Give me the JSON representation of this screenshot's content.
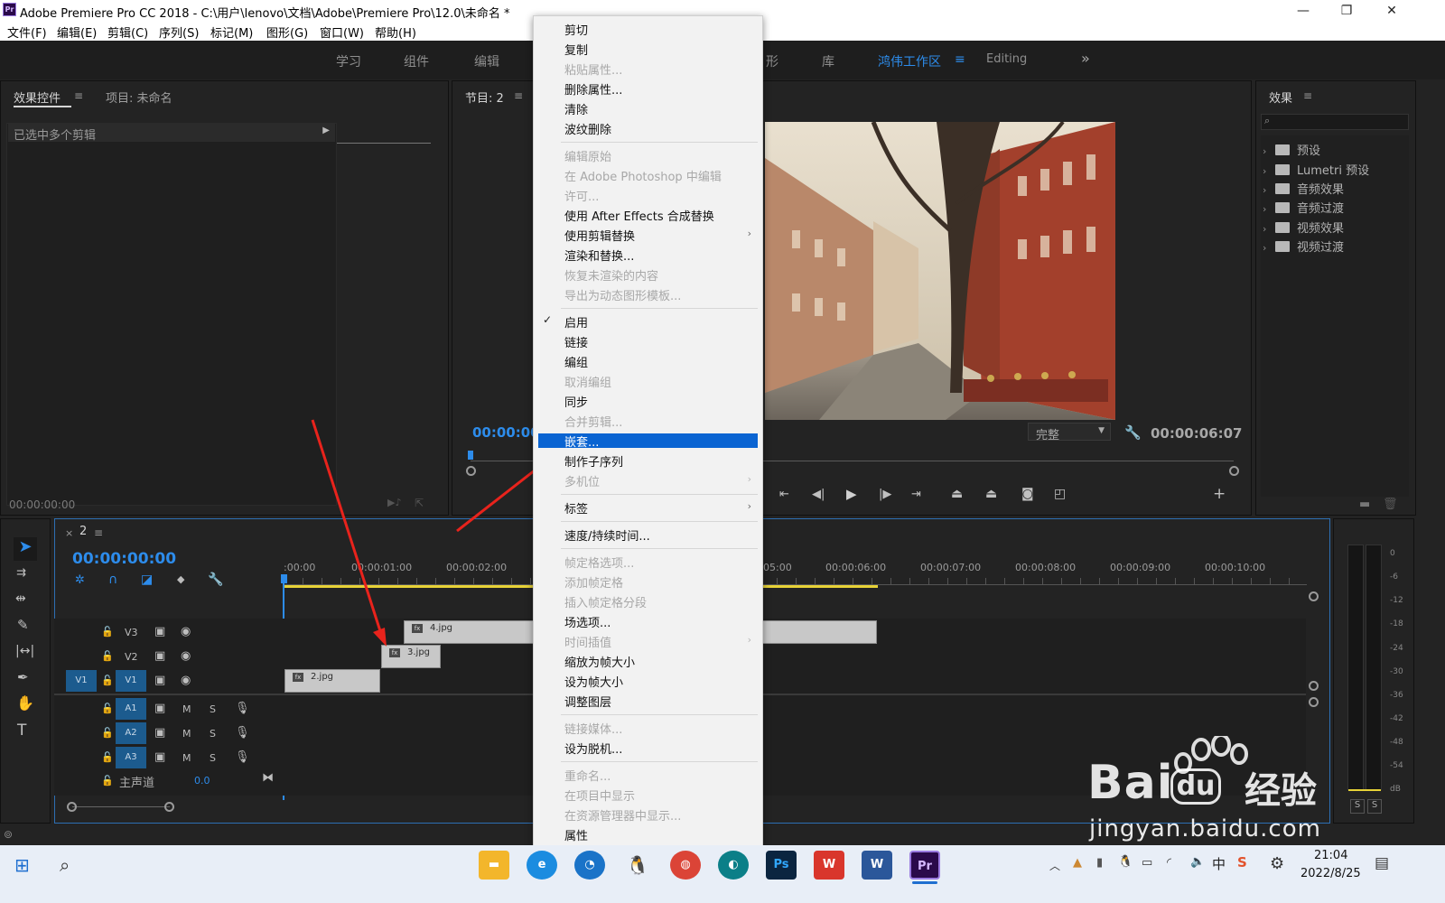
{
  "window": {
    "app_icon": "Pr",
    "title": "Adobe Premiere Pro CC 2018 - C:\\用户\\lenovo\\文档\\Adobe\\Premiere Pro\\12.0\\未命名 *",
    "minimize": "—",
    "restore": "❐",
    "close": "✕"
  },
  "menubar": [
    "文件(F)",
    "编辑(E)",
    "剪辑(C)",
    "序列(S)",
    "标记(M)",
    "图形(G)",
    "窗口(W)",
    "帮助(H)"
  ],
  "workspaces": {
    "items": [
      "学习",
      "组件",
      "编辑",
      "形",
      "库",
      "鸿伟工作区",
      "Editing"
    ],
    "active": "鸿伟工作区",
    "more": "»"
  },
  "effect_controls": {
    "tab_active": "效果控件",
    "tab_other": "项目: 未命名",
    "clip_header": "已选中多个剪辑",
    "timecode": "00:00:00:00"
  },
  "program_monitor": {
    "tab": "节目: 2",
    "timecode_left": "00:00:00:",
    "fit": "完整",
    "timecode_right": "00:00:06:07"
  },
  "effects_panel": {
    "tab": "效果",
    "items": [
      "预设",
      "Lumetri 预设",
      "音频效果",
      "音频过渡",
      "视频效果",
      "视频过渡"
    ]
  },
  "timeline": {
    "tab_close": "×",
    "tab": "2",
    "timecode": "00:00:00:00",
    "ruler": [
      ":00:00",
      "00:00:01:00",
      "00:00:02:00",
      "05:00",
      "00:00:06:00",
      "00:00:07:00",
      "00:00:08:00",
      "00:00:09:00",
      "00:00:10:00"
    ],
    "tracks": {
      "v3": "V3",
      "v2": "V2",
      "v1_src": "V1",
      "v1": "V1",
      "a1": "A1",
      "a2": "A2",
      "a3": "A3",
      "m": "M",
      "s": "S",
      "master": "主声道",
      "master_value": "0.0"
    },
    "clips": {
      "c4": "4.jpg",
      "c3": "3.jpg",
      "c2": "2.jpg",
      "fx": "fx"
    }
  },
  "audio_meter": {
    "scale": [
      "0",
      "-6",
      "-12",
      "-18",
      "-24",
      "-30",
      "-36",
      "-42",
      "-48",
      "-54",
      "dB"
    ],
    "solo_left": "S",
    "solo_right": "S"
  },
  "context_menu": {
    "items": [
      {
        "label": "剪切",
        "enabled": true
      },
      {
        "label": "复制",
        "enabled": true
      },
      {
        "label": "粘贴属性...",
        "enabled": false
      },
      {
        "label": "删除属性...",
        "enabled": true
      },
      {
        "label": "清除",
        "enabled": true
      },
      {
        "label": "波纹删除",
        "enabled": true
      },
      {
        "label": "编辑原始",
        "enabled": false
      },
      {
        "label": "在 Adobe Photoshop 中编辑",
        "enabled": false
      },
      {
        "label": "许可...",
        "enabled": false
      },
      {
        "label": "使用 After Effects 合成替换",
        "enabled": true
      },
      {
        "label": "使用剪辑替换",
        "enabled": true
      },
      {
        "label": "渲染和替换...",
        "enabled": true
      },
      {
        "label": "恢复未渲染的内容",
        "enabled": false
      },
      {
        "label": "导出为动态图形模板...",
        "enabled": false
      },
      {
        "label": "启用",
        "enabled": true
      },
      {
        "label": "链接",
        "enabled": true
      },
      {
        "label": "编组",
        "enabled": true
      },
      {
        "label": "取消编组",
        "enabled": false
      },
      {
        "label": "同步",
        "enabled": true
      },
      {
        "label": "合并剪辑...",
        "enabled": false
      },
      {
        "label": "嵌套...",
        "enabled": true
      },
      {
        "label": "制作子序列",
        "enabled": true
      },
      {
        "label": "多机位",
        "enabled": false
      },
      {
        "label": "标签",
        "enabled": true
      },
      {
        "label": "速度/持续时间...",
        "enabled": true
      },
      {
        "label": "帧定格选项...",
        "enabled": false
      },
      {
        "label": "添加帧定格",
        "enabled": false
      },
      {
        "label": "插入帧定格分段",
        "enabled": false
      },
      {
        "label": "场选项...",
        "enabled": true
      },
      {
        "label": "时间插值",
        "enabled": false
      },
      {
        "label": "缩放为帧大小",
        "enabled": true
      },
      {
        "label": "设为帧大小",
        "enabled": true
      },
      {
        "label": "调整图层",
        "enabled": true
      },
      {
        "label": "链接媒体...",
        "enabled": false
      },
      {
        "label": "设为脱机...",
        "enabled": true
      },
      {
        "label": "重命名...",
        "enabled": false
      },
      {
        "label": "在项目中显示",
        "enabled": false
      },
      {
        "label": "在资源管理器中显示...",
        "enabled": false
      },
      {
        "label": "属性",
        "enabled": true
      }
    ],
    "highlighted": "嵌套...",
    "checked": "启用",
    "check_glyph": "✓",
    "submenu_glyph": "›"
  },
  "taskbar": {
    "time": "21:04",
    "date": "2022/8/25",
    "ime": "中",
    "ps": "Ps",
    "pr": "Pr",
    "w": "W"
  },
  "watermark": {
    "brand_left": "Bai",
    "brand_du": "du",
    "brand_right": "经验",
    "url": "jingyan.baidu.com"
  },
  "colors": {
    "accent": "#2d8ceb",
    "menu_highlight": "#0a64d2",
    "annotation_arrow": "#e8231c",
    "playhead": "#2d8ceb",
    "work_area": "#e7d237"
  }
}
